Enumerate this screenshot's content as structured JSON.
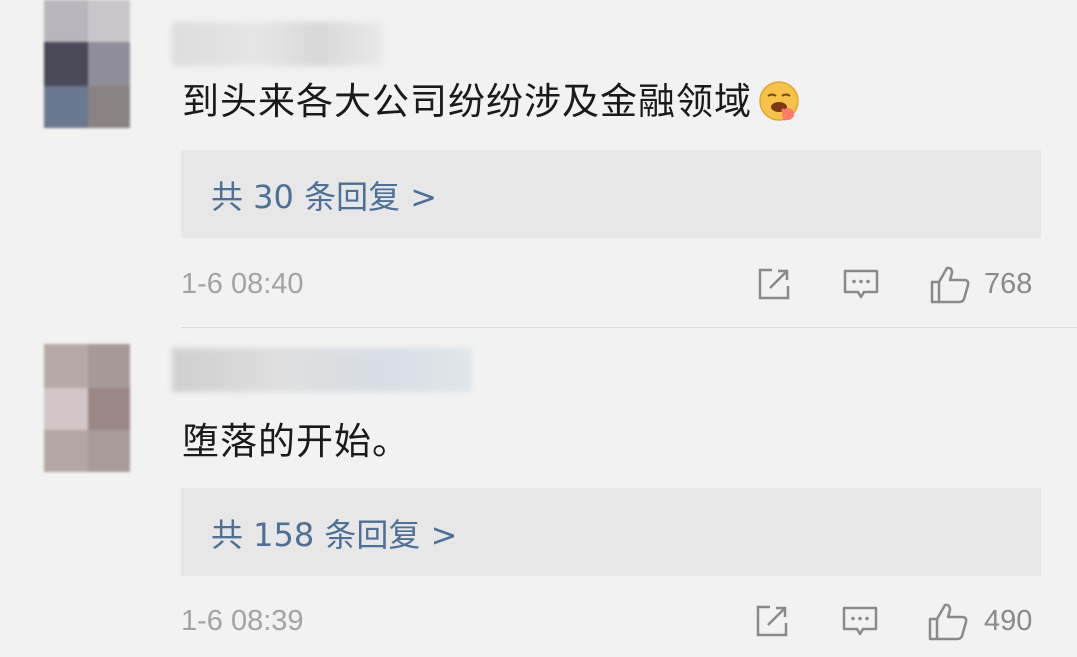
{
  "comments": [
    {
      "text": "到头来各大公司纷纷涉及金融领域",
      "emoji_icon": "drooling-face-emoji",
      "reply_link": "共 30 条回复 >",
      "time": "1-6 08:40",
      "likes": "768"
    },
    {
      "text": "堕落的开始。",
      "reply_link": "共 158 条回复 >",
      "time": "1-6 08:39",
      "likes": "490"
    }
  ],
  "icons": {
    "share": "share-icon",
    "comment": "comment-icon",
    "like": "thumbs-up-icon"
  },
  "colors": {
    "background": "#f2f2f2",
    "reply_box": "#e7e7e7",
    "link": "#4e6f96",
    "meta_text": "#a3a3a3"
  }
}
